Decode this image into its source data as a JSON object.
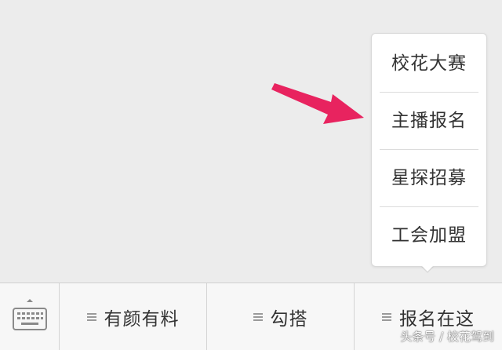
{
  "popup_menu": {
    "items": [
      "校花大赛",
      "主播报名",
      "星探招募",
      "工会加盟"
    ]
  },
  "menubar": {
    "items": [
      "有颜有料",
      "勾搭",
      "报名在这"
    ]
  },
  "watermark": "头条号 / 校花驾到",
  "colors": {
    "arrow": "#e8235f",
    "background": "#ececec",
    "popup": "#ffffff",
    "text": "#333333"
  }
}
